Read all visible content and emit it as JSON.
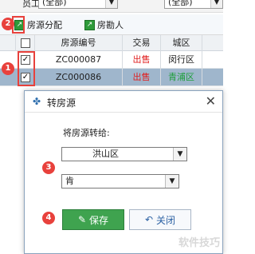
{
  "filter_bar": {
    "label": "员工",
    "combo1_value": "(全部)",
    "combo2_value": "(全部)"
  },
  "toolbar": {
    "assign_label": "房源分配",
    "survey_label": "房勘人"
  },
  "grid": {
    "columns": [
      "",
      "房源编号",
      "交易",
      "城区"
    ],
    "rows": [
      {
        "checked": "✓",
        "code": "ZC000087",
        "deal": "出售",
        "district": "闵行区"
      },
      {
        "checked": "✓",
        "code": "ZC000086",
        "deal": "出售",
        "district": "青浦区"
      }
    ]
  },
  "markers": [
    "1",
    "2",
    "3",
    "4"
  ],
  "dialog": {
    "title": "转房源",
    "prompt": "将房源转给:",
    "district_value": "洪山区",
    "person_value": "肯",
    "save_label": "保存",
    "cancel_label": "关闭"
  },
  "watermark": "软件技巧",
  "colors": {
    "sale": "#e02020",
    "district_selected": "#1e9e3a",
    "save_button": "#3fa34f",
    "marker": "#e8413c"
  }
}
